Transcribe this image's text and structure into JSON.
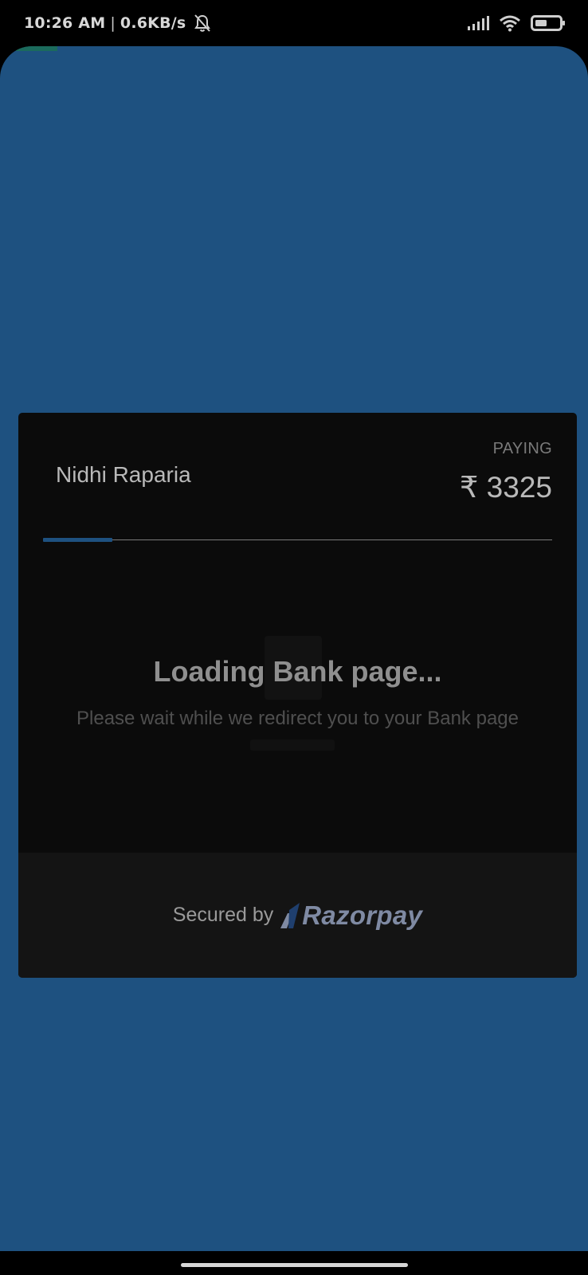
{
  "status_bar": {
    "time": "10:26 AM",
    "separator": "|",
    "speed": "0.6KB/s",
    "icons": [
      "bell-off-icon",
      "signal-icon",
      "wifi-icon",
      "battery-icon"
    ]
  },
  "checkout": {
    "merchant_name": "Nidhi Raparia",
    "paying_label": "PAYING",
    "amount": "₹ 3325",
    "loading_title": "Loading Bank page...",
    "loading_subtitle": "Please wait while we redirect you to your Bank page",
    "footer": {
      "secured_by": "Secured by",
      "brand": "Razorpay"
    }
  },
  "colors": {
    "app_background": "#1e5180",
    "card_background": "#0b0b0b",
    "footer_background": "#141414",
    "accent": "#1e5180"
  }
}
